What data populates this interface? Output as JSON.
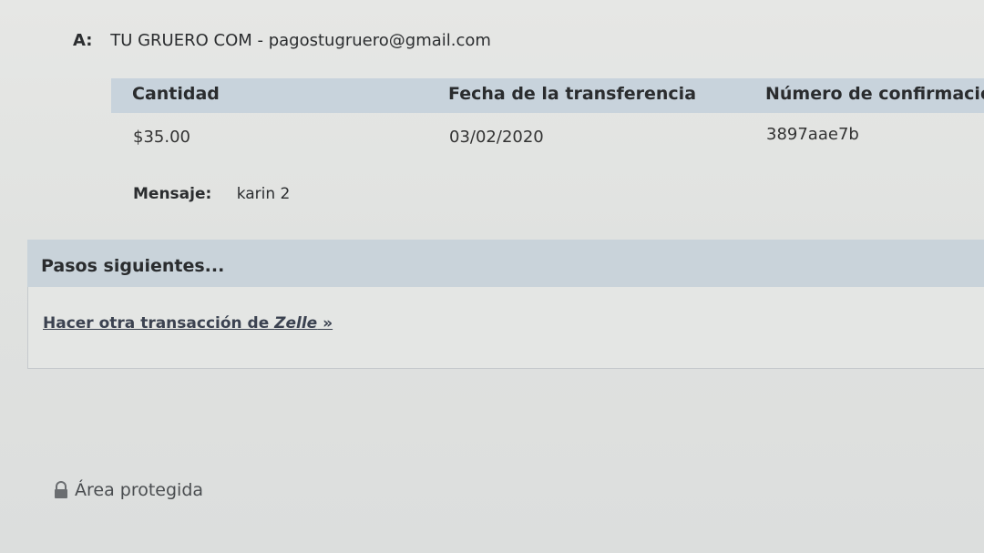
{
  "recipient": {
    "label": "A:",
    "value": "TU GRUERO COM - pagostugruero@gmail.com"
  },
  "transfer_table": {
    "headers": [
      "Cantidad",
      "Fecha de la transferencia",
      "Número de confirmació"
    ],
    "row": [
      "$35.00",
      "03/02/2020",
      "3897aae7b"
    ]
  },
  "message": {
    "label": "Mensaje:",
    "value": "karin 2"
  },
  "next_steps": {
    "title": "Pasos siguientes...",
    "link_prefix": "Hacer otra transacción de ",
    "link_brand": "Zelle",
    "link_suffix": " »"
  },
  "footer": {
    "protected_label": "Área protegida",
    "icon": "lock-icon"
  },
  "colors": {
    "header_bg": "#c8d3dc",
    "page_bg": "#e3e5e3"
  }
}
